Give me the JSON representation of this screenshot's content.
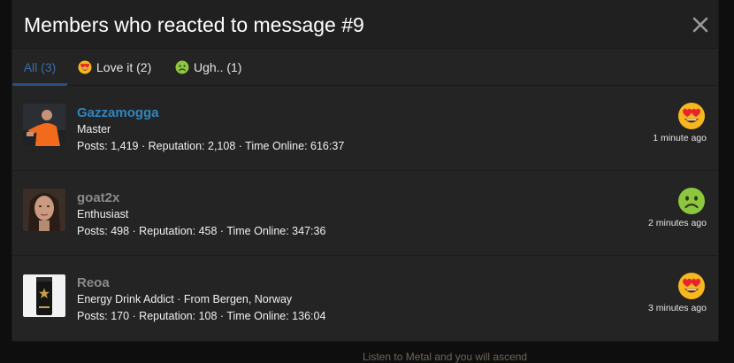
{
  "modal": {
    "title": "Members who reacted to message #9",
    "close_icon": "close-icon"
  },
  "tabs": [
    {
      "label": "All (3)",
      "icon": null,
      "active": true
    },
    {
      "label": "Love it (2)",
      "icon": "heart-eyes-emoji",
      "active": false
    },
    {
      "label": "Ugh.. (1)",
      "icon": "sick-face-emoji",
      "active": false
    }
  ],
  "members": [
    {
      "username": "Gazzamogga",
      "username_color": "#2e86c1",
      "title": "Master",
      "stats": "Posts: 1,419 · Reputation: 2,108 · Time Online: 616:37",
      "reaction_icon": "heart-eyes-emoji",
      "time": "1 minute ago"
    },
    {
      "username": "goat2x",
      "username_color": "#8a8a8a",
      "title": "Enthusiast",
      "stats": "Posts: 498 · Reputation: 458 · Time Online: 347:36",
      "reaction_icon": "sick-face-emoji",
      "time": "2 minutes ago"
    },
    {
      "username": "Reoa",
      "username_color": "#8a8a8a",
      "title": "Energy Drink Addict · From Bergen, Norway",
      "stats": "Posts: 170 · Reputation: 108 · Time Online: 136:04",
      "reaction_icon": "heart-eyes-emoji",
      "time": "3 minutes ago"
    }
  ],
  "background": {
    "footer_text": "Listen to Metal and you will ascend"
  },
  "colors": {
    "active_tab": "#3a6ea8",
    "modal_bg": "#242424"
  }
}
